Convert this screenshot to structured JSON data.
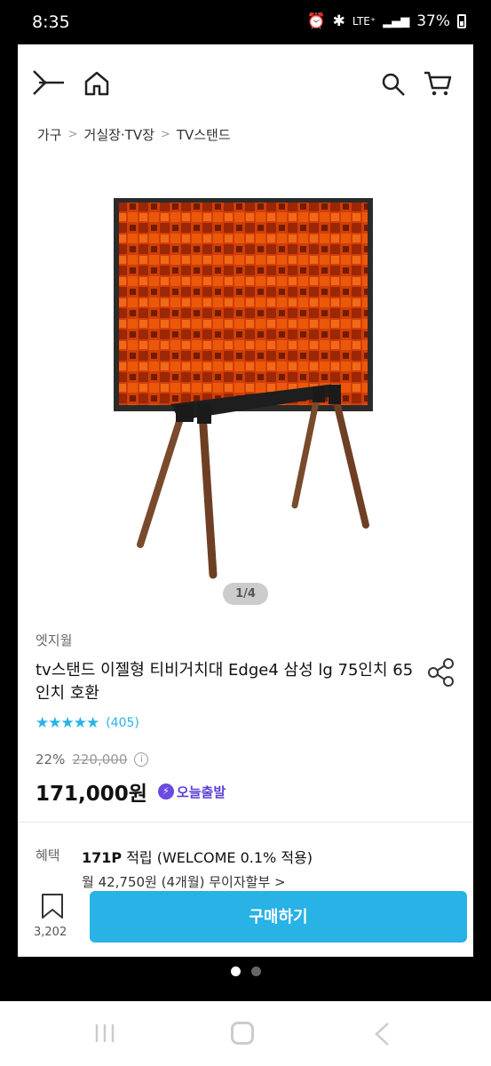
{
  "status_bar": {
    "time": "8:35",
    "network": "LTE⁺",
    "battery": "37%"
  },
  "breadcrumb": {
    "items": [
      "가구",
      "거실장·TV장",
      "TV스탠드"
    ],
    "separator": ">"
  },
  "gallery": {
    "indicator": "1/4"
  },
  "product": {
    "brand": "엣지월",
    "title": "tv스탠드 이젤형 티비거치대 Edge4 삼성 lg 75인치 65인치 호환",
    "rating_stars": "★★★★★",
    "rating": 5,
    "review_count": "(405)",
    "discount": "22%",
    "original_price": "220,000",
    "price": "171,000원",
    "delivery_badge": "오늘출발"
  },
  "benefit": {
    "label": "혜택",
    "points": "171P",
    "points_text": " 적립 (WELCOME 0.1% 적용)",
    "installment": "월 42,750원 (4개월) 무이자할부 >"
  },
  "bottom_bar": {
    "wish_count": "3,202",
    "buy_label": "구매하기"
  },
  "colors": {
    "accent": "#28b2e6",
    "star": "#28b4e6",
    "delivery": "#5b3fd9"
  },
  "page_indicator": {
    "pages": 2,
    "active": 0
  }
}
